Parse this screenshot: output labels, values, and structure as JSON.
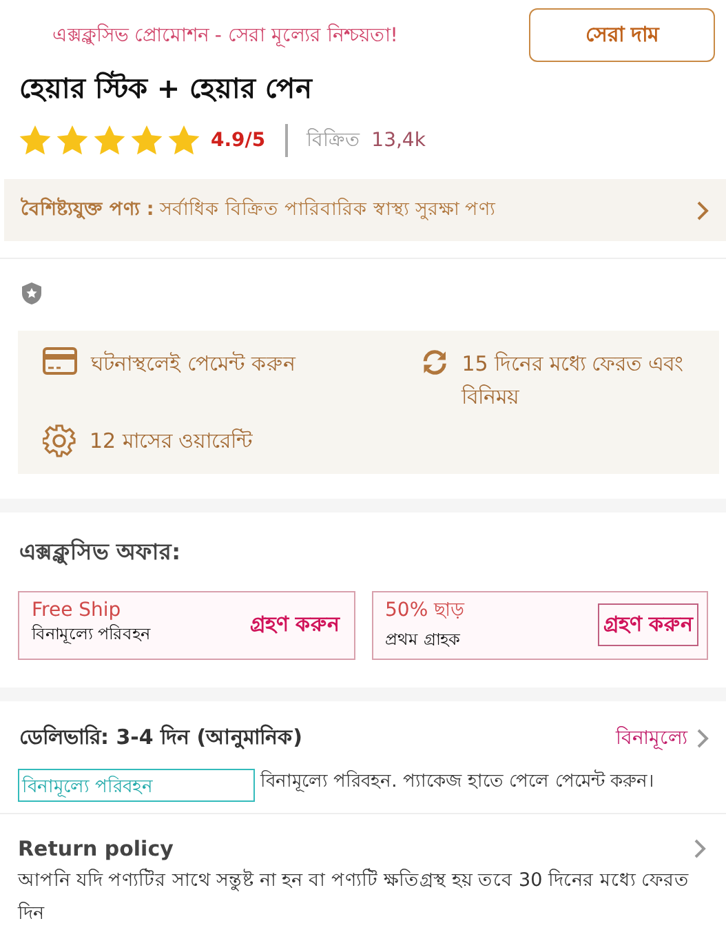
{
  "promo": {
    "text": "এক্সক্লুসিভ প্রোমোশন - সেরা মূল্যের নিশ্চয়তা!",
    "badge": "সেরা দাম"
  },
  "product": {
    "title": "হেয়ার স্টিক + হেয়ার পেন",
    "stars": 5,
    "rating": "4.9/5",
    "sold_label": "বিক্রিত",
    "sold_count": "13,4k"
  },
  "feature": {
    "label": "বৈশিষ্ট্যযুক্ত পণ্য :",
    "text": "সর্বাধিক বিক্রিত পারিবারিক স্বাস্থ্য সুরক্ষা পণ্য"
  },
  "services": [
    {
      "kind": "card",
      "text": "ঘটনাস্থলেই পেমেন্ট করুন"
    },
    {
      "kind": "refresh",
      "text": "15 দিনের মধ্যে ফেরত এবং বিনিময়"
    },
    {
      "kind": "gear",
      "text": "12 মাসের ওয়ারেন্টি"
    }
  ],
  "offers": {
    "title": "এক্সক্লুসিভ অফার:",
    "items": [
      {
        "name": "Free Ship",
        "detail": "বিনামূল্যে পরিবহন",
        "action": "গ্রহণ করুন",
        "focused": false
      },
      {
        "name": "50% ছাড়",
        "detail": "প্রথম গ্রাহক",
        "action": "গ্রহণ করুন",
        "focused": true
      }
    ]
  },
  "delivery": {
    "title": "ডেলিভারি: 3-4 দিন (আনুমানিক)",
    "price": "বিনামূল্যে",
    "tag": "বিনামূল্যে পরিবহন",
    "note": "বিনামূল্যে পরিবহন. প্যাকেজ হাতে পেলে পেমেন্ট করুন।"
  },
  "return_policy": {
    "title": "Return policy",
    "text": "আপনি যদি পণ্যটির সাথে সন্তুষ্ট না হন বা পণ্যটি ক্ষতিগ্রস্থ হয় তবে 30 দিনের মধ্যে ফেরত দিন"
  }
}
